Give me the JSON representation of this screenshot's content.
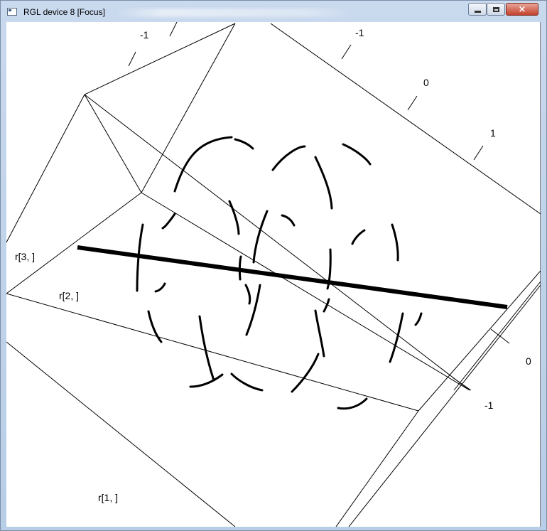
{
  "window": {
    "title": "RGL device 8 [Focus]",
    "controls": {
      "minimize": "minimize",
      "maximize": "maximize",
      "close": "×"
    }
  },
  "plot": {
    "axis_labels": {
      "x": "r[1, ]",
      "y": "r[2, ]",
      "z": "r[3, ]"
    },
    "tick_labels": {
      "top_left": "-1",
      "top_a": "-1",
      "top_b": "0",
      "top_c": "1",
      "right_a": "0",
      "right_b": "-1"
    },
    "line_color": "#000000",
    "background": "#ffffff"
  }
}
